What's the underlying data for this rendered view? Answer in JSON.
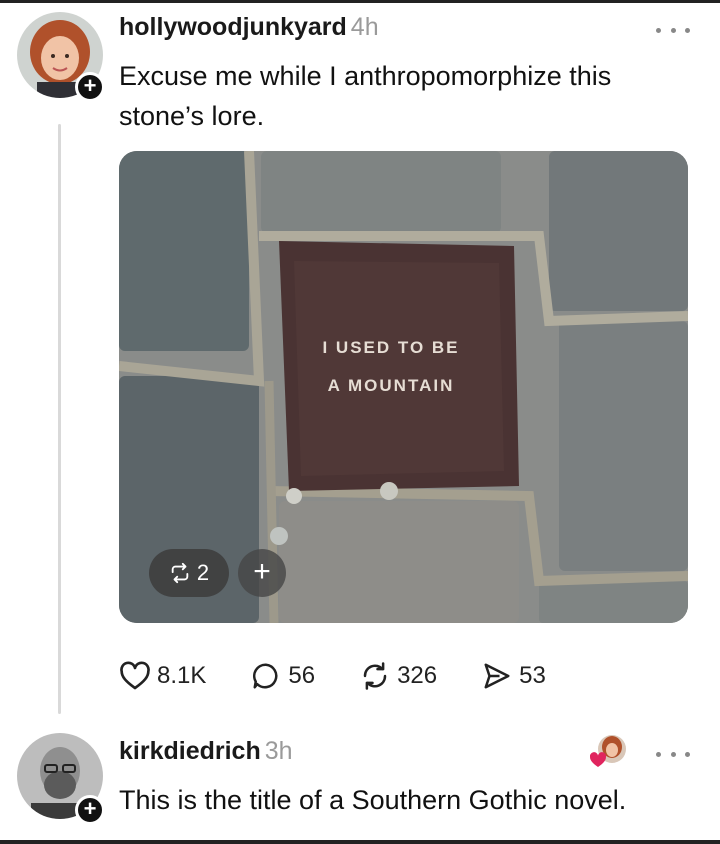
{
  "post": {
    "username": "hollywoodjunkyard",
    "time": "4h",
    "text_line1": "Excuse me while I anthropomorphize this",
    "text_line2": "stone’s lore.",
    "image": {
      "engraving_line1": "I USED TO BE",
      "engraving_line2": "A MOUNTAIN",
      "repost_count": "2"
    },
    "stats": {
      "likes": "8.1K",
      "replies": "56",
      "reposts": "326",
      "shares": "53"
    }
  },
  "reply": {
    "username": "kirkdiedrich",
    "time": "3h",
    "text": "This is the title of a Southern Gothic novel."
  },
  "icons": [
    "more-icon",
    "heart-icon",
    "comment-icon",
    "repost-icon",
    "share-icon",
    "plus-icon"
  ],
  "colors": {
    "text": "#111111",
    "muted": "#9a9a9a",
    "thread_line": "#d9d9d9",
    "heart": "#e0245e"
  }
}
